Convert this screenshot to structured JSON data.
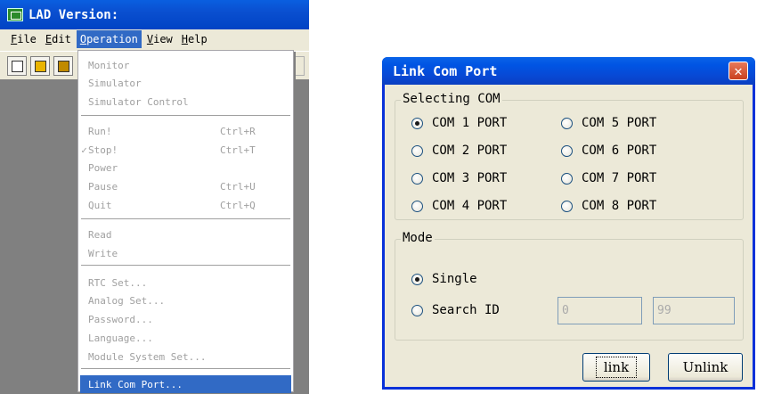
{
  "app": {
    "title": "LAD Version:",
    "menubar": [
      {
        "key": "F",
        "rest": "ile"
      },
      {
        "key": "E",
        "rest": "dit"
      },
      {
        "key": "O",
        "rest": "peration"
      },
      {
        "key": "V",
        "rest": "iew"
      },
      {
        "key": "H",
        "rest": "elp"
      }
    ],
    "toolbar_icons": [
      "new-file-icon",
      "open-folder-icon",
      "save-icon"
    ]
  },
  "dropdown": {
    "items": [
      {
        "label": "Monitor",
        "shortcut": ""
      },
      {
        "label": "Simulator",
        "shortcut": ""
      },
      {
        "label": "Simulator Control",
        "shortcut": ""
      },
      {
        "label": "Run!",
        "shortcut": "Ctrl+R"
      },
      {
        "label": "Stop!",
        "shortcut": "Ctrl+T",
        "checked": true
      },
      {
        "label": "Power",
        "shortcut": ""
      },
      {
        "label": "Pause",
        "shortcut": "Ctrl+U"
      },
      {
        "label": "Quit",
        "shortcut": "Ctrl+Q"
      },
      {
        "label": "Read",
        "shortcut": ""
      },
      {
        "label": "Write",
        "shortcut": ""
      },
      {
        "label": "RTC Set...",
        "shortcut": ""
      },
      {
        "label": "Analog Set...",
        "shortcut": ""
      },
      {
        "label": "Password...",
        "shortcut": ""
      },
      {
        "label": "Language...",
        "shortcut": ""
      },
      {
        "label": "Module System Set...",
        "shortcut": ""
      },
      {
        "label": "Link Com Port...",
        "shortcut": "",
        "highlighted": true
      }
    ],
    "check_mark": "✓"
  },
  "dialog": {
    "title": "Link Com Port",
    "close_label": "✕",
    "com_group": {
      "legend": "Selecting COM",
      "ports": [
        "COM 1 PORT",
        "COM 2 PORT",
        "COM 3 PORT",
        "COM 4 PORT",
        "COM 5 PORT",
        "COM 6 PORT",
        "COM 7 PORT",
        "COM 8 PORT"
      ],
      "selected": "COM 1 PORT"
    },
    "mode_group": {
      "legend": "Mode",
      "single_label": "Single",
      "search_label": "Search ID",
      "selected": "Single",
      "search_from": "0",
      "search_to": "99"
    },
    "buttons": {
      "link": "link",
      "unlink": "Unlink"
    }
  }
}
